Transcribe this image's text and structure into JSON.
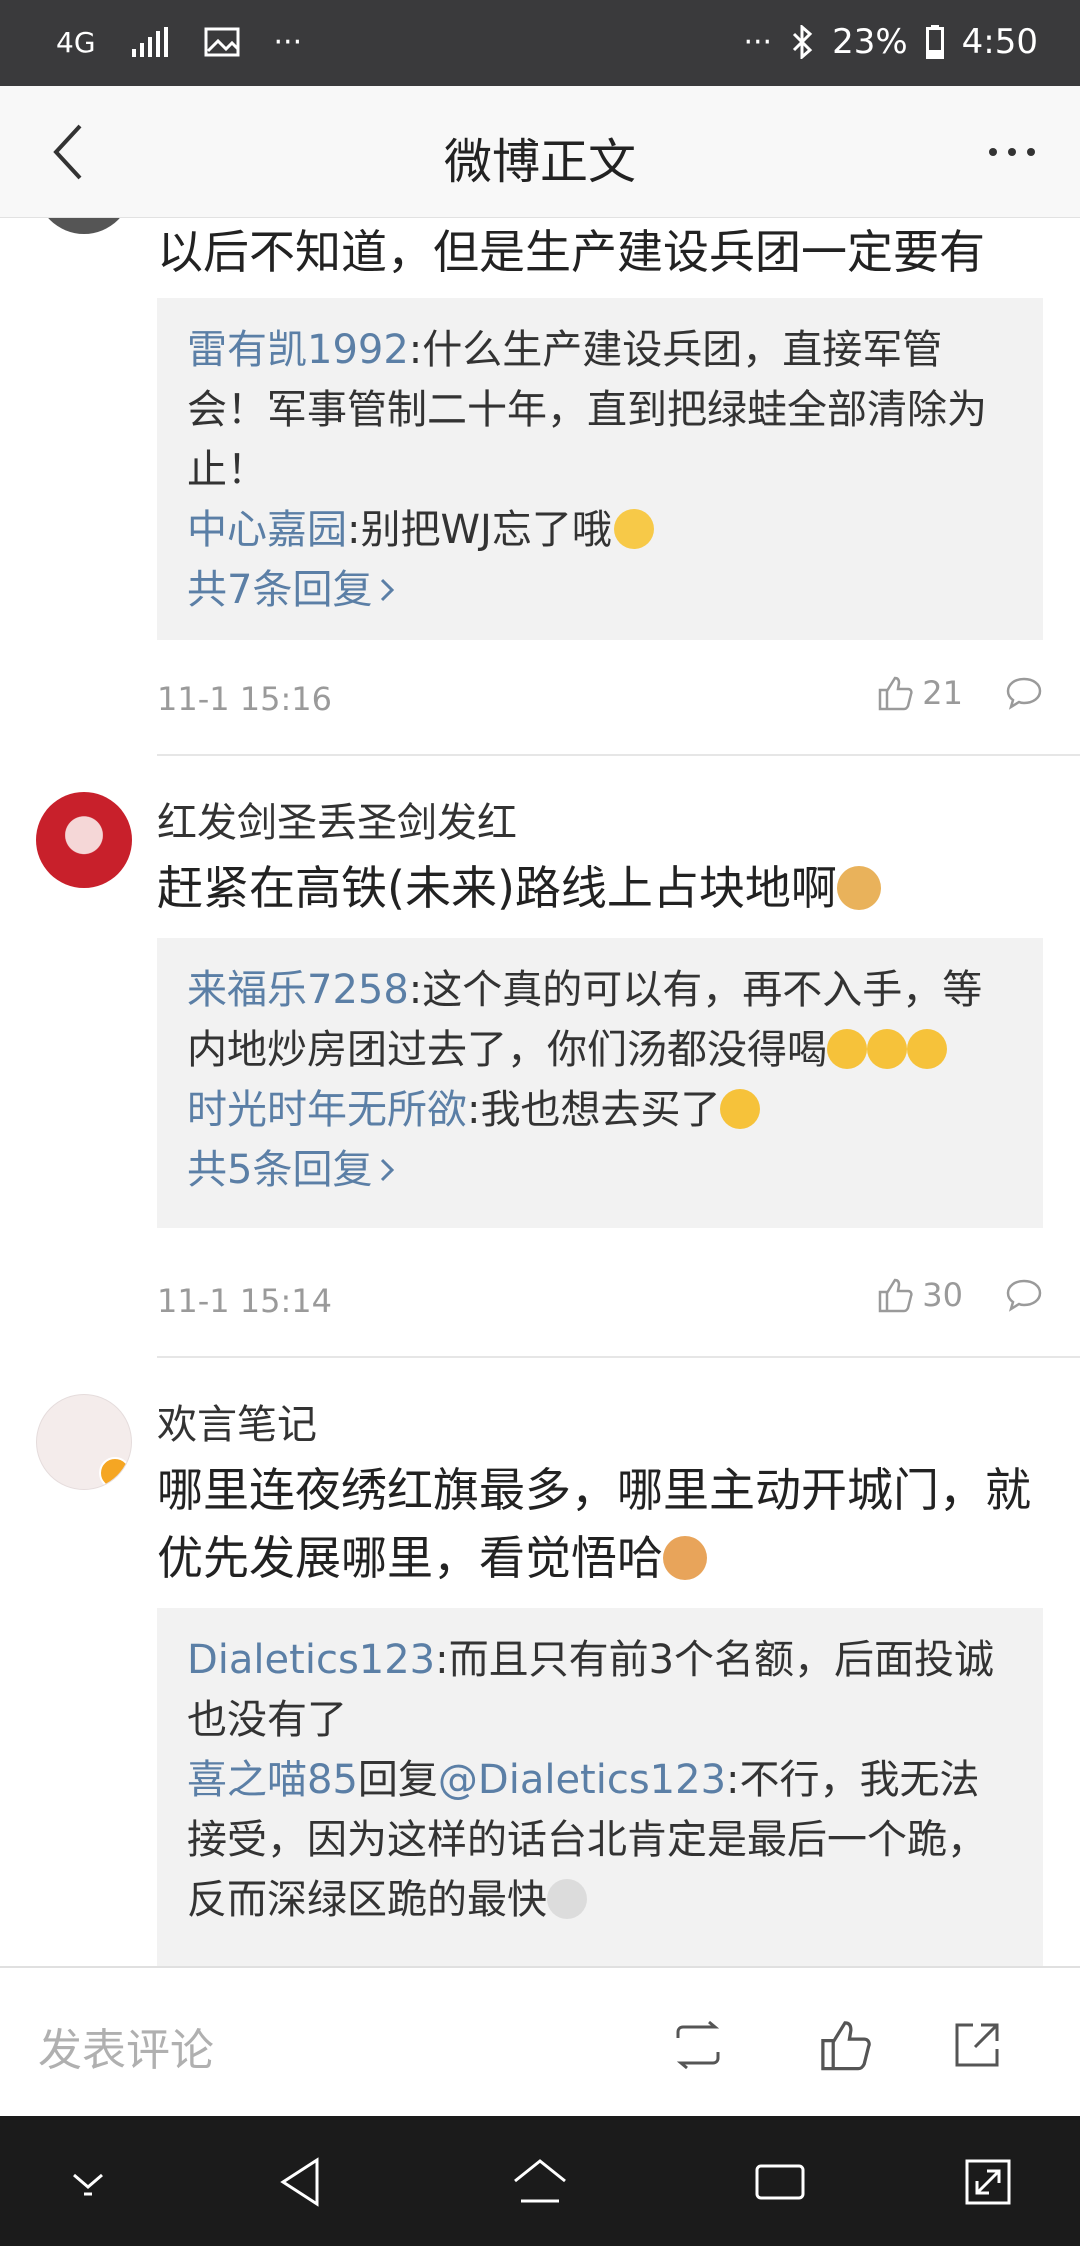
{
  "status_bar": {
    "network": "4G",
    "dots_left": "···",
    "dots_right": "···",
    "battery": "23%",
    "time": "4:50"
  },
  "header": {
    "title": "微博正文"
  },
  "comments": [
    {
      "text": "以后不知道，但是生产建设兵团一定要有",
      "replies": [
        {
          "user": "雷有凯1992",
          "text": ":什么生产建设兵团，直接军管会！军事管制二十年，直到把绿蛙全部清除为止！"
        },
        {
          "user": "中心嘉园",
          "text": ":别把WJ忘了哦"
        }
      ],
      "more_replies": "共7条回复",
      "time": "11-1 15:16",
      "likes": "21"
    },
    {
      "username": "红发剑圣丢圣剑发红",
      "text": "赶紧在高铁(未来)路线上占块地啊",
      "replies": [
        {
          "user": "来福乐7258",
          "text": ":这个真的可以有，再不入手，等内地炒房团过去了，你们汤都没得喝"
        },
        {
          "user": "时光时年无所欲",
          "text": ":我也想去买了"
        }
      ],
      "more_replies": "共5条回复",
      "time": "11-1 15:14",
      "likes": "30"
    },
    {
      "username": "欢言笔记",
      "text": "哪里连夜绣红旗最多，哪里主动开城门，就优先发展哪里，看觉悟哈",
      "replies": [
        {
          "user": "Dialetics123",
          "text": ":而且只有前3个名额，后面投诚也没有了"
        },
        {
          "user": "喜之喵85",
          "reply_word": "回复",
          "mention": "@Dialetics123",
          "text": ":不行，我无法接受，因为这样的话台北肯定是最后一个跪，反而深绿区跪的最快"
        }
      ]
    }
  ],
  "bottom_bar": {
    "input_placeholder": "发表评论"
  },
  "colors": {
    "link": "#5b7fa6",
    "status_bar": "#3a3a3c",
    "nav_bar": "#1b1b1b",
    "reply_bg": "#f2f2f2"
  }
}
